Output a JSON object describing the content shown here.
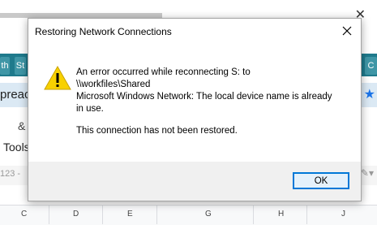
{
  "background": {
    "tab_left": "th",
    "tab_st": "St",
    "tab_right": "C",
    "address_partial": "preac",
    "toolbar_text": "Tools",
    "formula_partial": "123 -",
    "columns": [
      "C",
      "D",
      "E",
      "G",
      "H",
      "J"
    ],
    "colors": {
      "tab_bar": "#1f7a8c",
      "address_bar": "#dbe9f4"
    }
  },
  "dialog": {
    "title": "Restoring Network Connections",
    "close_icon": "close-icon",
    "warning_icon": "warning-icon",
    "message": {
      "line1": "An error occurred while reconnecting S: to",
      "line2": "\\\\workfiles\\Shared",
      "line3": "Microsoft Windows Network: The local device name is already",
      "line4": "in use.",
      "line5": "This connection has not been restored."
    },
    "ok_label": "OK",
    "colors": {
      "ok_border": "#0078d7",
      "footer": "#f0f0f0",
      "warning": "#f8d100"
    }
  }
}
